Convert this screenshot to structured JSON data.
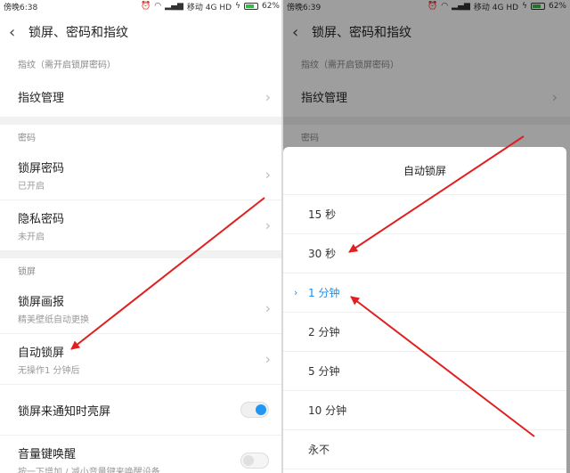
{
  "left": {
    "status": {
      "time": "傍晚6:38",
      "carrier": "移动 4G HD",
      "battery": "62%"
    },
    "title": "锁屏、密码和指纹",
    "sections": [
      {
        "header": "指纹（需开启锁屏密码）",
        "items": [
          {
            "title": "指纹管理"
          }
        ]
      },
      {
        "header": "密码",
        "items": [
          {
            "title": "锁屏密码",
            "sub": "已开启"
          },
          {
            "title": "隐私密码",
            "sub": "未开启"
          }
        ]
      },
      {
        "header": "锁屏",
        "items": [
          {
            "title": "锁屏画报",
            "sub": "精美壁纸自动更换"
          },
          {
            "title": "自动锁屏",
            "sub": "无操作1 分钟后"
          },
          {
            "title": "锁屏来通知时亮屏"
          },
          {
            "title": "音量键唤醒",
            "sub": "按一下增加 / 减小音量键来唤醒设备"
          }
        ]
      }
    ]
  },
  "right": {
    "status": {
      "time": "傍晚6:39",
      "carrier": "移动 4G HD",
      "battery": "62%"
    },
    "title": "锁屏、密码和指纹",
    "sections": [
      {
        "header": "指纹（需开启锁屏密码）",
        "items": [
          {
            "title": "指纹管理"
          }
        ]
      },
      {
        "header": "密码"
      }
    ],
    "dialog": {
      "title": "自动锁屏",
      "selected_mark": "›",
      "options": [
        "15 秒",
        "30 秒",
        "1 分钟",
        "2 分钟",
        "5 分钟",
        "10 分钟",
        "永不"
      ],
      "selected_index": 2
    }
  },
  "toggles": {
    "notify_wake": true,
    "volume_wake": false
  },
  "colors": {
    "accent": "#1a8ff3",
    "arrow": "#e02020",
    "toggle_on": "#2196f3"
  }
}
